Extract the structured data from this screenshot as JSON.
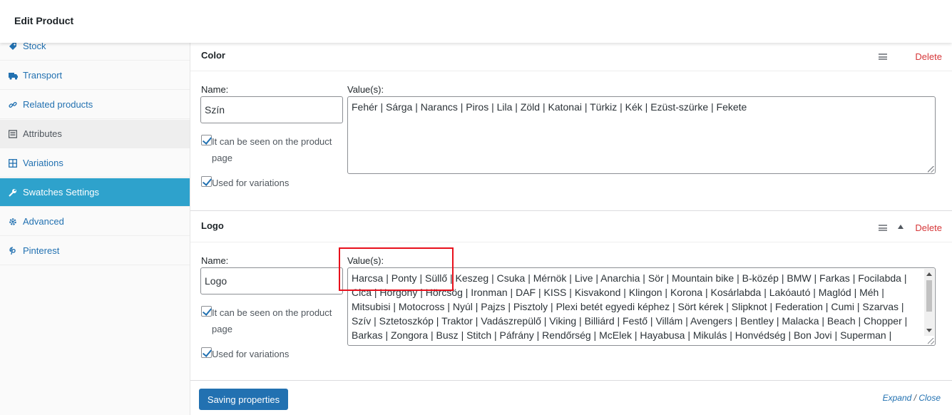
{
  "header": {
    "title": "Edit Product"
  },
  "sidebar": {
    "items": [
      {
        "label": "Stock",
        "icon": "tag-icon"
      },
      {
        "label": "Transport",
        "icon": "truck-icon"
      },
      {
        "label": "Related products",
        "icon": "link-icon"
      },
      {
        "label": "Attributes",
        "icon": "list-icon"
      },
      {
        "label": "Variations",
        "icon": "grid-icon"
      },
      {
        "label": "Swatches Settings",
        "icon": "wrench-icon"
      },
      {
        "label": "Advanced",
        "icon": "gear-icon"
      },
      {
        "label": "Pinterest",
        "icon": "pinterest-icon"
      }
    ],
    "active_item": "Swatches Settings"
  },
  "attributes": [
    {
      "title": "Color",
      "delete_label": "Delete",
      "name_label": "Name:",
      "name_value": "Szín",
      "values_label": "Value(s):",
      "values_text": "Fehér | Sárga | Narancs | Piros | Lila | Zöld | Katonai | Türkiz | Kék | Ezüst-szürke | Fekete",
      "visible_label": "It can be seen on the product page",
      "variations_label": "Used for variations"
    },
    {
      "title": "Logo",
      "delete_label": "Delete",
      "name_label": "Name:",
      "name_value": "Logo",
      "values_label": "Value(s):",
      "values_text": "Harcsa | Ponty | Süllő | Keszeg | Csuka | Mérnök | Live | Anarchia | Sör | Mountain bike | B-közép | BMW | Farkas | Focilabda | Cica | Horgony | Hörcsög | Ironman | DAF | KISS | Kisvakond | Klingon | Korona | Kosárlabda | Lakóautó | Maglód | Méh | Mitsubisi | Motocross | Nyúl | Pajzs | Pisztoly | Plexi betét egyedi képhez | Sört kérek | Slipknot | Federation | Cumi | Szarvas | Szív | Sztetoszkóp | Traktor | Vadászrepülő | Viking | Billiárd | Festő | Villám | Avengers | Bentley | Malacka | Beach | Chopper | Barkas | Zongora | Busz | Stitch | Páfrány | Rendőrség | McElek | Hayabusa | Mikulás | Honvédség | Bon Jovi | Superman | Aranyszarvas |",
      "visible_label": "It can be seen on the product page",
      "variations_label": "Used for variations"
    }
  ],
  "footer": {
    "save_label": "Saving properties",
    "expand_label": "Expand",
    "separator": " / ",
    "close_label": "Close"
  },
  "colors": {
    "accent": "#2271b1",
    "active_tab": "#2ea2cc",
    "delete": "#d63638",
    "highlight": "#e8101c"
  }
}
